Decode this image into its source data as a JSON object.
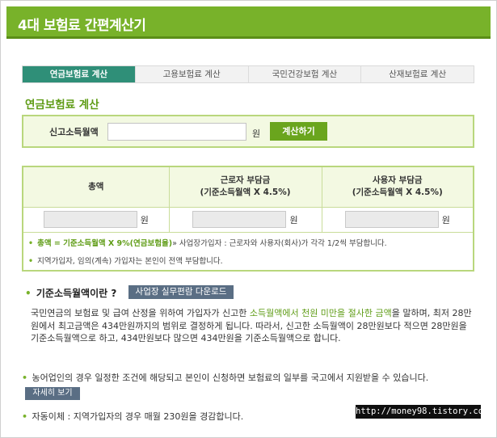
{
  "banner": {
    "title": "4대 보험료 간편계산기"
  },
  "tabs": [
    {
      "label": "연금보험료 계산",
      "active": true
    },
    {
      "label": "고용보험료 계산",
      "active": false
    },
    {
      "label": "국민건강보험 계산",
      "active": false
    },
    {
      "label": "산재보험료 계산",
      "active": false
    }
  ],
  "section_title": "연금보험료 계산",
  "input": {
    "label": "신고소득월액",
    "value": "",
    "unit": "원",
    "calc_button": "계산하기"
  },
  "result": {
    "headers": {
      "total": "총액",
      "worker_line1": "근로자 부담금",
      "worker_line2": "(기준소득월액 X 4.5%)",
      "employer_line1": "사용자 부담금",
      "employer_line2": "(기준소득월액 X 4.5%)"
    },
    "unit": "원",
    "values": {
      "total": "",
      "worker": "",
      "employer": ""
    },
    "notes": {
      "n1_highlight": "총액 = 기준소득월액 X 9%(연금보험율)",
      "n1_rest": "» 사업장가입자 : 근로자와 사용자(회사)가 각각 1/2씩 부담합니다.",
      "n2": "지역가입자, 임의(계속) 가입자는 본인이 전액 부담합니다."
    }
  },
  "info": {
    "question": "기준소득월액이란 ?",
    "download_button": "사업장 실무편람 다운로드",
    "para_start": "국민연금의 보험료 및 급여 산정을 위하여 가입자가 신고한 ",
    "para_highlight": "소득월액에서 천원 미만을 절사한 금액",
    "para_end": "을 말하며, 최저 28만원에서 최고금액은 434만원까지의 범위로 결정하게 됩니다. 따라서, 신고한 소득월액이 28만원보다 적으면 28만원을 기준소득월액으로 하고, 434만원보다 많으면 434만원을 기준소득월액으로 합니다.",
    "farm_text": "농어업인의 경우 일정한 조건에 해당되고 본인이 신청하면 보험료의 일부를 국고에서 지원받을 수 있습니다.",
    "detail_button": "자세히 보기",
    "auto_transfer": "자동이체 : 지역가입자의 경우 매월 230원을 경감합니다."
  },
  "watermark": "http://money98.tistory.com",
  "colors": {
    "brand_green": "#78b22a",
    "active_tab": "#2f8f78",
    "button_slate": "#5a6e84"
  }
}
